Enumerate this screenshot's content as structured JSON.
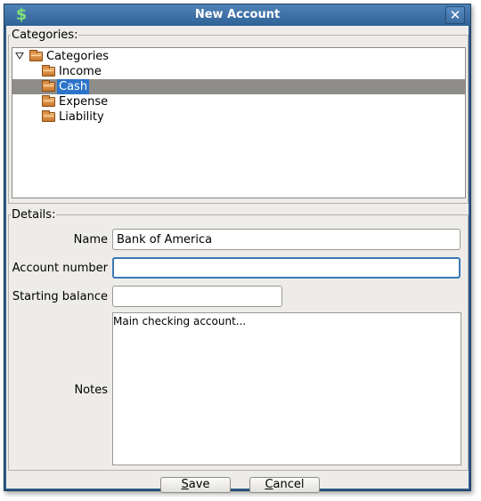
{
  "window": {
    "title": "New Account",
    "icon": "dollar-icon",
    "icon_glyph": "$",
    "close_glyph": "✕"
  },
  "categories": {
    "legend": "Categories:",
    "tree": [
      {
        "label": "Categories",
        "expanded": true,
        "selected": false,
        "level": 0
      },
      {
        "label": "Income",
        "selected": false,
        "level": 1
      },
      {
        "label": "Cash",
        "selected": true,
        "level": 1
      },
      {
        "label": "Expense",
        "selected": false,
        "level": 1
      },
      {
        "label": "Liability",
        "selected": false,
        "level": 1
      }
    ]
  },
  "details": {
    "legend": "Details:",
    "name_label": "Name",
    "name_value": "Bank of America",
    "account_number_label": "Account number",
    "account_number_value": "",
    "starting_balance_label": "Starting balance",
    "starting_balance_value": "",
    "notes_label": "Notes",
    "notes_value": "Main checking account..."
  },
  "buttons": {
    "save_mnemonic": "S",
    "save_rest": "ave",
    "cancel_mnemonic": "C",
    "cancel_rest": "ancel"
  },
  "colors": {
    "title_bar": "#2f6296",
    "selection": "#2c74c9",
    "selected_row": "#8e8d8a",
    "focus_border": "#3b78b5",
    "folder": "#d88c42"
  }
}
